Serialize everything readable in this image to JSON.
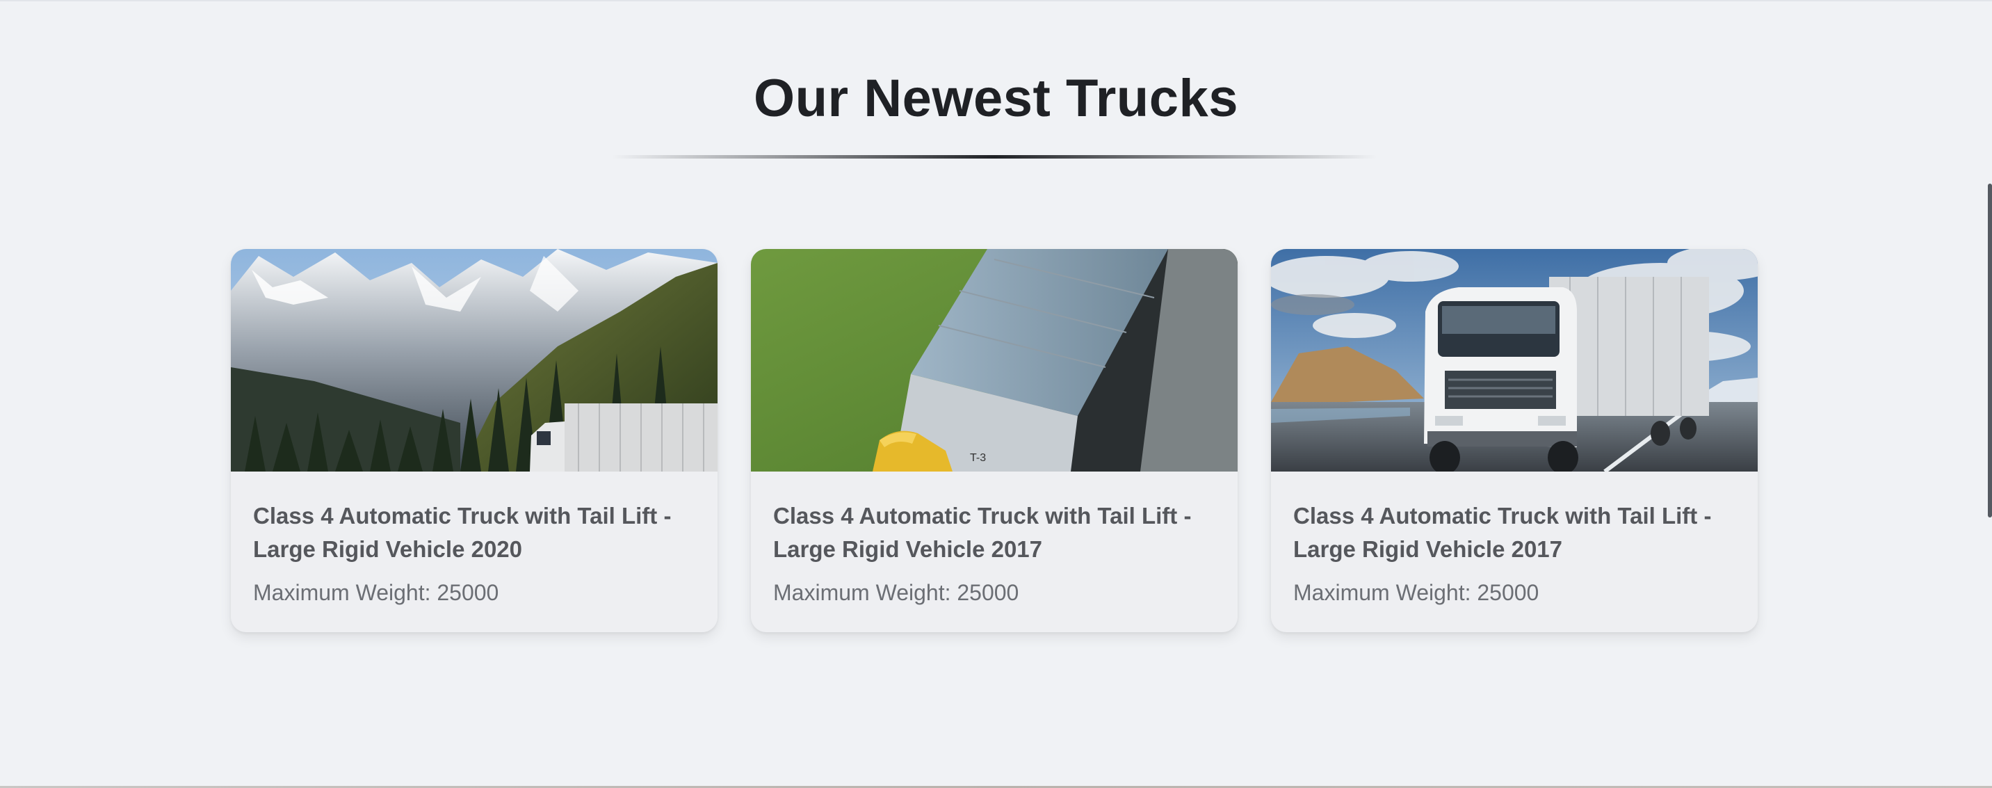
{
  "section": {
    "title": "Our Newest Trucks"
  },
  "cards": [
    {
      "image_name": "mountain-highway-truck-photo",
      "title": "Class 4 Automatic Truck with Tail Lift - Large Rigid Vehicle 2020",
      "weight": "Maximum Weight: 25000"
    },
    {
      "image_name": "aerial-trailer-truck-photo",
      "title": "Class 4 Automatic Truck with Tail Lift - Large Rigid Vehicle 2017",
      "weight": "Maximum Weight: 25000"
    },
    {
      "image_name": "white-semi-truck-road-photo",
      "title": "Class 4 Automatic Truck with Tail Lift - Large Rigid Vehicle 2017",
      "weight": "Maximum Weight: 25000"
    }
  ],
  "colors": {
    "background": "#f0f2f5",
    "card_background": "#eeeff2",
    "heading": "#1f2125",
    "card_title": "#55575c",
    "card_meta": "#6b6e74"
  }
}
